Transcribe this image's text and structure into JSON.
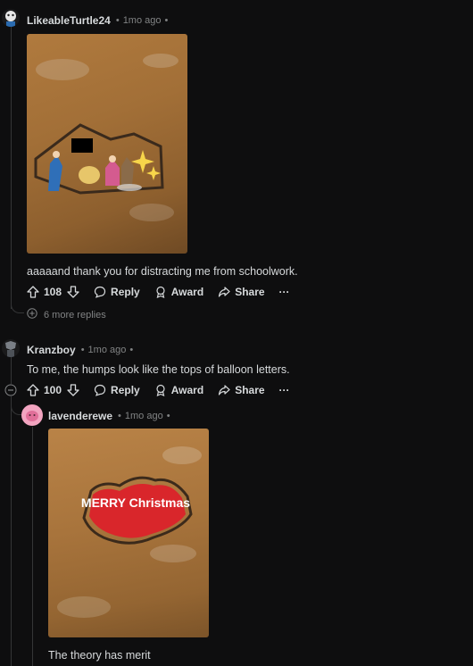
{
  "comments": [
    {
      "username": "LikeableTurtle24",
      "time": "1mo ago",
      "text": "aaaaand thank you for distracting me from schoolwork.",
      "votes": "108",
      "reply_label": "Reply",
      "award_label": "Award",
      "share_label": "Share",
      "more_label": "···",
      "more_replies": "6 more replies"
    },
    {
      "username": "Kranzboy",
      "time": "1mo ago",
      "text": "To me, the humps look like the tops of balloon letters.",
      "votes": "100",
      "reply_label": "Reply",
      "award_label": "Award",
      "share_label": "Share",
      "more_label": "···"
    },
    {
      "username": "lavenderewe",
      "time": "1mo ago",
      "text": "The theory has merit",
      "image_text": "MERRY Christmas"
    }
  ],
  "colors": {
    "background": "#0e0e0f",
    "text": "#d7dadc",
    "meta": "#818384",
    "thread_line": "#343536"
  }
}
